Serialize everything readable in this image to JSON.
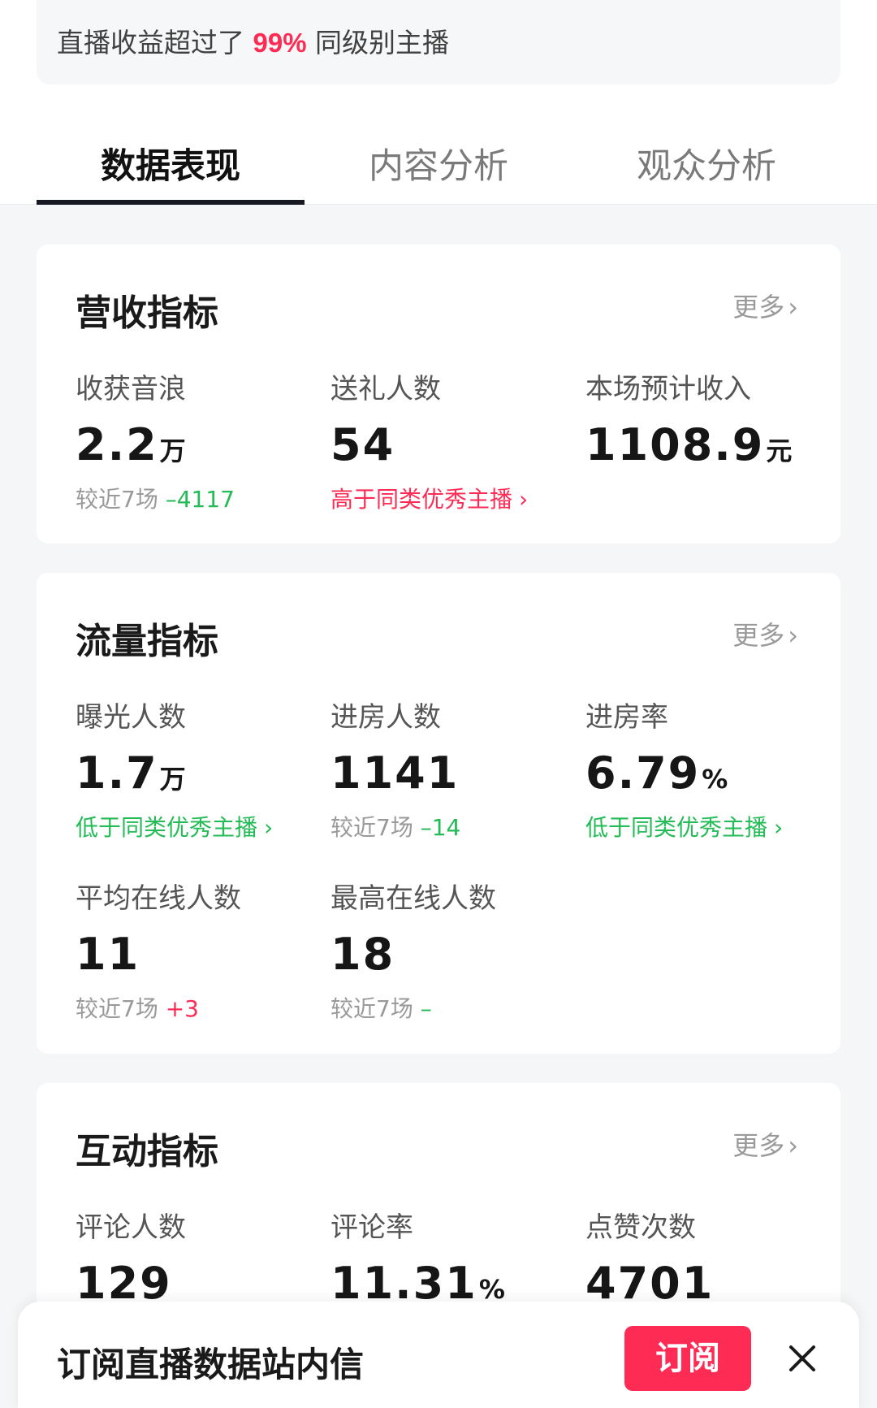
{
  "banner": {
    "prefix": "直播收益超过了 ",
    "highlight": "99%",
    "suffix": " 同级别主播"
  },
  "tabs": [
    {
      "label": "数据表现",
      "active": true
    },
    {
      "label": "内容分析",
      "active": false
    },
    {
      "label": "观众分析",
      "active": false
    }
  ],
  "revenue": {
    "title": "营收指标",
    "more": "更多",
    "metrics": [
      {
        "label": "收获音浪",
        "value": "2.2",
        "unit": "万",
        "sub_gray": "较近7场 ",
        "sub_color": "–4117"
      },
      {
        "label": "送礼人数",
        "value": "54",
        "unit": "",
        "sub_color": "高于同类优秀主播"
      },
      {
        "label": "本场预计收入",
        "value": "1108.9",
        "unit": "元"
      }
    ]
  },
  "traffic": {
    "title": "流量指标",
    "more": "更多",
    "metrics": [
      {
        "label": "曝光人数",
        "value": "1.7",
        "unit": "万",
        "sub_color": "低于同类优秀主播"
      },
      {
        "label": "进房人数",
        "value": "1141",
        "unit": "",
        "sub_gray": "较近7场 ",
        "sub_color": "–14"
      },
      {
        "label": "进房率",
        "value": "6.79",
        "unit": "%",
        "sub_color": "低于同类优秀主播"
      },
      {
        "label": "平均在线人数",
        "value": "11",
        "unit": "",
        "sub_gray": "较近7场 ",
        "sub_color": "+3"
      },
      {
        "label": "最高在线人数",
        "value": "18",
        "unit": "",
        "sub_gray": "较近7场 ",
        "sub_color": "–"
      }
    ]
  },
  "interaction": {
    "title": "互动指标",
    "more": "更多",
    "metrics": [
      {
        "label": "评论人数",
        "value": "129",
        "unit": ""
      },
      {
        "label": "评论率",
        "value": "11.31",
        "unit": "%"
      },
      {
        "label": "点赞次数",
        "value": "4701",
        "unit": ""
      }
    ]
  },
  "subscribe_bar": {
    "text": "订阅直播数据站内信",
    "button": "订阅"
  },
  "colors": {
    "accent": "#fe2c55",
    "positive": "#22bb55",
    "tab_indicator": "#161823"
  },
  "icons": {
    "more_chevron": "chevron-right-icon",
    "close": "close-icon"
  }
}
